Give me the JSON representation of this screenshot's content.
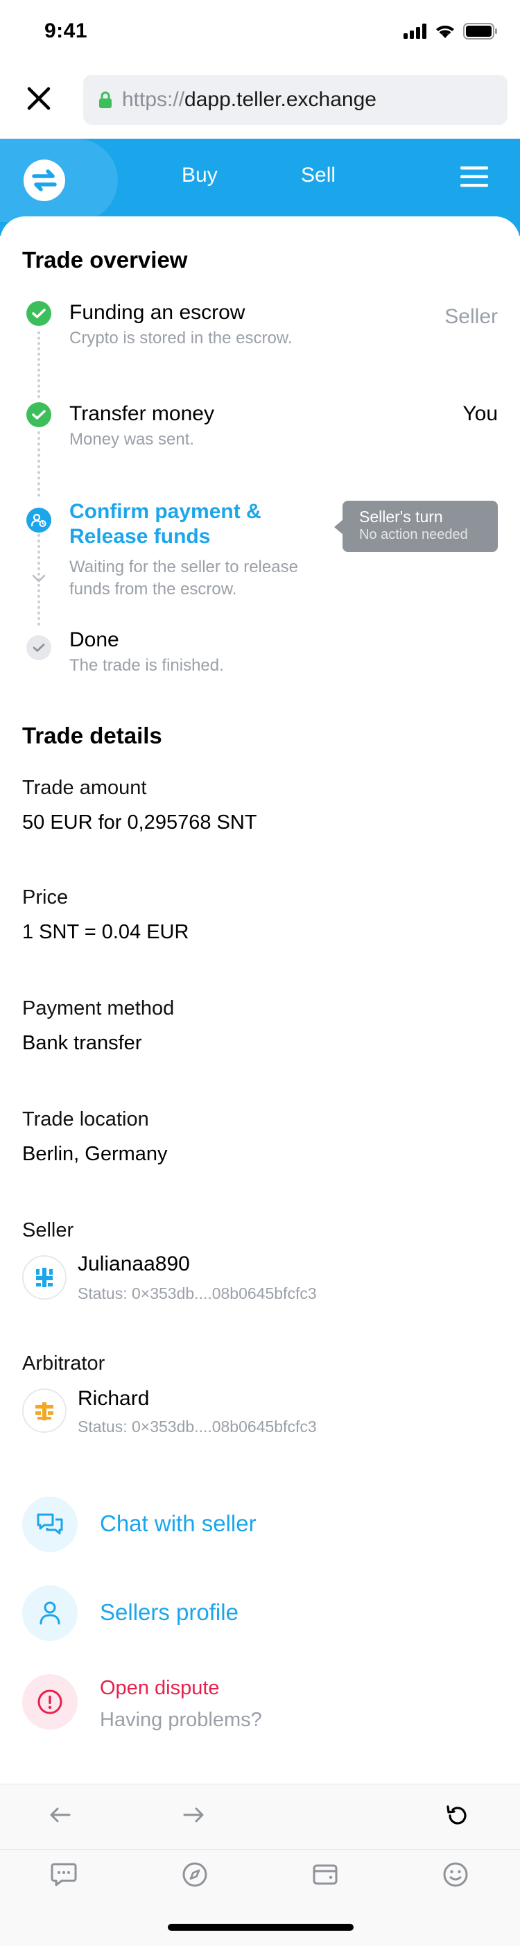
{
  "status_bar": {
    "time": "9:41"
  },
  "browser": {
    "url_scheme": "https://",
    "url_host": "dapp.teller.exchange"
  },
  "header": {
    "nav_buy": "Buy",
    "nav_sell": "Sell"
  },
  "trade_overview": {
    "title": "Trade overview",
    "steps": [
      {
        "title": "Funding an escrow",
        "subtitle": "Crypto is stored in the escrow.",
        "actor": "Seller",
        "state": "done"
      },
      {
        "title": "Transfer money",
        "subtitle": "Money was sent.",
        "actor": "You",
        "state": "done"
      },
      {
        "title_line1": "Confirm payment &",
        "title_line2": "Release funds",
        "subtitle_line1": "Waiting for the seller to release",
        "subtitle_line2": "funds from the escrow.",
        "state": "active"
      },
      {
        "title": "Done",
        "subtitle": "The trade is finished.",
        "state": "pending"
      }
    ],
    "tooltip": {
      "title": "Seller's turn",
      "subtitle": "No action needed"
    }
  },
  "trade_details": {
    "title": "Trade details",
    "amount": {
      "label": "Trade amount",
      "value": "50 EUR for 0,295768 SNT"
    },
    "price": {
      "label": "Price",
      "value": "1 SNT = 0.04 EUR"
    },
    "payment": {
      "label": "Payment method",
      "value": "Bank transfer"
    },
    "location": {
      "label": "Trade location",
      "value": "Berlin, Germany"
    },
    "seller": {
      "label": "Seller",
      "name": "Julianaa890",
      "status": "Status: 0×353db....08b0645bfcfc3"
    },
    "arbitrator": {
      "label": "Arbitrator",
      "name": "Richard",
      "status": "Status: 0×353db....08b0645bfcfc3"
    }
  },
  "actions": {
    "chat": "Chat with seller",
    "profile": "Sellers profile",
    "dispute_title": "Open dispute",
    "dispute_subtitle": "Having problems?"
  },
  "colors": {
    "brand": "#1ba6ec",
    "success": "#3cbf5a",
    "danger": "#e8204e",
    "muted": "#9aa0a8"
  },
  "icons": {
    "close": "close-icon",
    "lock": "lock-icon",
    "logo": "swap-logo-icon",
    "menu": "hamburger-icon",
    "chat": "chat-icon",
    "profile": "user-icon",
    "dispute": "info-icon",
    "back": "arrow-left-icon",
    "forward": "arrow-right-icon",
    "reload": "reload-icon"
  }
}
